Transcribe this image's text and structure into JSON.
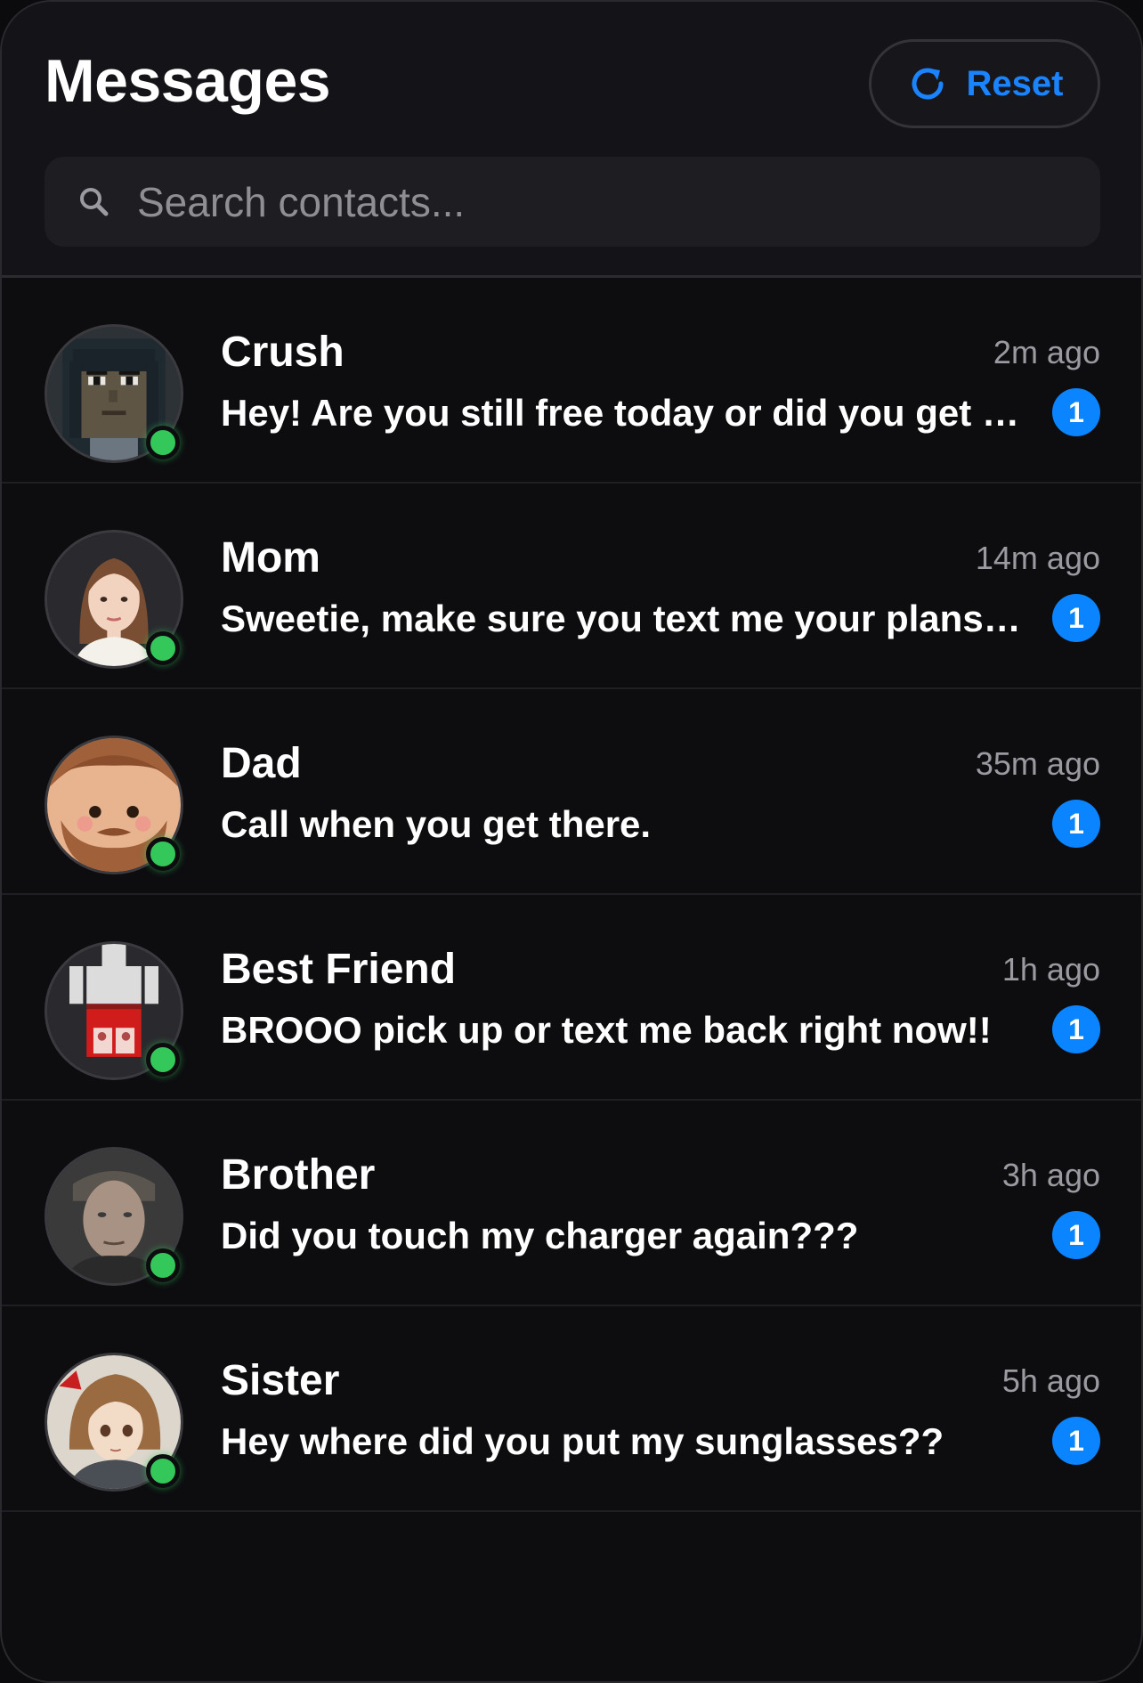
{
  "header": {
    "title": "Messages",
    "reset_label": "Reset",
    "reset_icon": "refresh-icon"
  },
  "search": {
    "placeholder": "Search contacts...",
    "value": "",
    "icon": "search-icon"
  },
  "colors": {
    "accent": "#0a84ff",
    "online": "#34c759",
    "background": "#0d0d10"
  },
  "contacts": [
    {
      "name": "Crush",
      "time": "2m ago",
      "preview": "Hey! Are you still free today or did you get grounded?",
      "unread": "1",
      "avatar": "pixel-art-woman-avatar",
      "online": true
    },
    {
      "name": "Mom",
      "time": "14m ago",
      "preview": "Sweetie, make sure you text me your plans for tonight",
      "unread": "1",
      "avatar": "illustrated-woman-avatar",
      "online": true
    },
    {
      "name": "Dad",
      "time": "35m ago",
      "preview": "Call when you get there.",
      "unread": "1",
      "avatar": "cartoon-bearded-man-avatar",
      "online": true
    },
    {
      "name": "Best Friend",
      "time": "1h ago",
      "preview": "BROOO pick up or text me back right now!!",
      "unread": "1",
      "avatar": "blocky-character-avatar",
      "online": true
    },
    {
      "name": "Brother",
      "time": "3h ago",
      "preview": "Did you touch my charger again???",
      "unread": "1",
      "avatar": "photo-man-avatar",
      "online": true
    },
    {
      "name": "Sister",
      "time": "5h ago",
      "preview": "Hey where did you put my sunglasses??",
      "unread": "1",
      "avatar": "anime-girl-avatar",
      "online": true
    }
  ]
}
